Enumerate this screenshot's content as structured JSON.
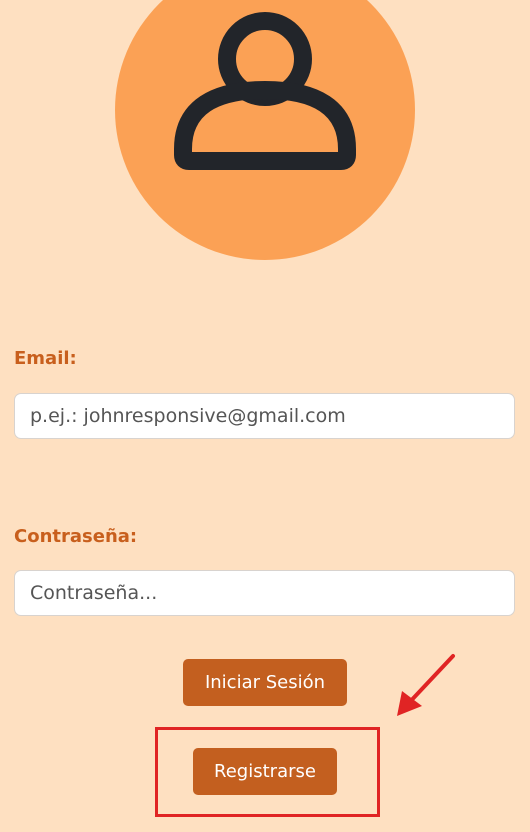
{
  "profile": {
    "avatar_icon": "user-icon"
  },
  "login_form": {
    "email": {
      "label": "Email:",
      "placeholder": "p.ej.: johnresponsive@gmail.com",
      "value": ""
    },
    "password": {
      "label": "Contraseña:",
      "placeholder": "Contraseña...",
      "value": ""
    },
    "login_button_label": "Iniciar Sesión",
    "register_button_label": "Registrarse"
  },
  "annotation": {
    "highlight_color": "#e02424",
    "arrow_icon": "arrow-icon"
  },
  "colors": {
    "background": "#fee0c1",
    "avatar_circle": "#fba155",
    "accent": "#c35f1f",
    "label": "#c85f1d"
  }
}
